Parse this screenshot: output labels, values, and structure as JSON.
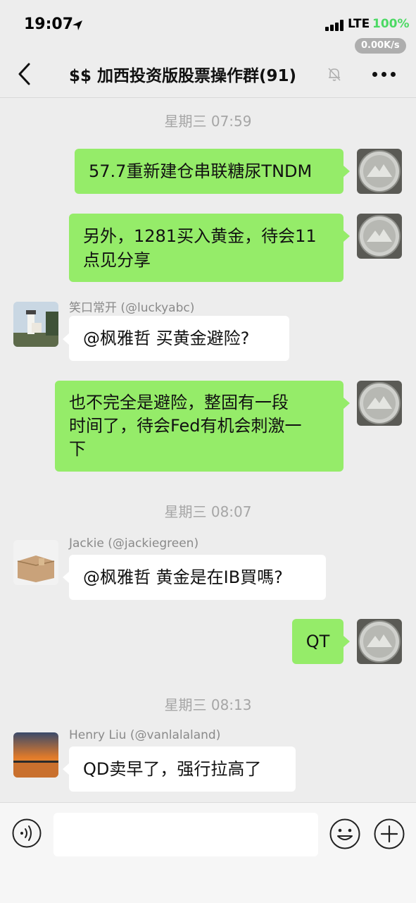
{
  "status_bar": {
    "time": "19:07",
    "network": "LTE",
    "battery": "100%",
    "speed": "0.00K/s"
  },
  "nav": {
    "title": "$$ 加西投资版股票操作群(91)",
    "back_icon": "chevron-left-icon",
    "mute_icon": "bell-slash-icon",
    "more_icon": "more-icon"
  },
  "timestamps": [
    "星期三 07:59",
    "星期三 08:07",
    "星期三 08:13"
  ],
  "messages": [
    {
      "from": "me",
      "lines": [
        "57.7重新建仓串联糖尿TNDM"
      ]
    },
    {
      "from": "me",
      "lines": [
        "另外，1281买入黄金，待会11",
        "点见分享"
      ]
    },
    {
      "from": "other",
      "sender": "笑口常开 (@luckyabc)",
      "lines": [
        "@枫雅哲 买黄金避险?"
      ]
    },
    {
      "from": "me",
      "lines": [
        "也不完全是避险，整固有一段",
        "时间了，待会Fed有机会刺激一",
        "下"
      ]
    },
    {
      "from": "other",
      "sender": "Jackie (@jackiegreen)",
      "lines": [
        "@枫雅哲 黄金是在IB買嗎?"
      ]
    },
    {
      "from": "me",
      "lines": [
        "QT"
      ]
    },
    {
      "from": "other",
      "sender": "Henry Liu (@vanlalaland)",
      "lines": [
        "QD卖早了，强行拉高了"
      ]
    }
  ],
  "input_bar": {
    "voice_icon": "voice-icon",
    "placeholder": "",
    "emoji_icon": "emoji-icon",
    "plus_icon": "plus-icon"
  },
  "colors": {
    "background": "#ededed",
    "my_bubble": "#95ec69",
    "other_bubble": "#ffffff",
    "battery": "#4cd964"
  }
}
